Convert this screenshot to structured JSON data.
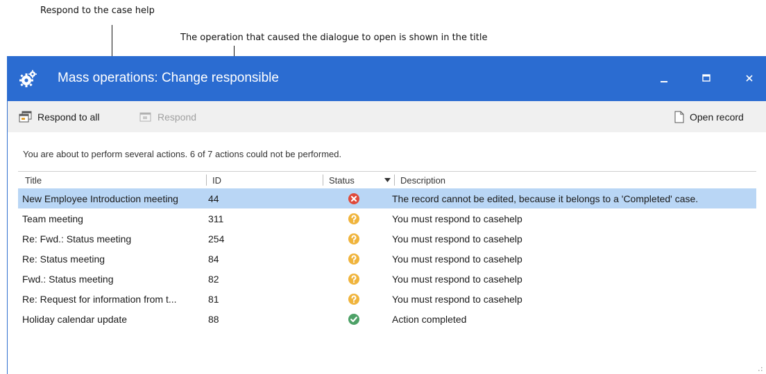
{
  "annotations": {
    "respond_help": "Respond to the case help",
    "title_note": "The operation that caused the dialogue to open is shown in the title"
  },
  "window": {
    "title": "Mass operations: Change responsible",
    "icon": "gears-icon",
    "controls": [
      "minimize-icon",
      "maximize-icon",
      "close-icon"
    ],
    "accent_color": "#2b6cd1"
  },
  "toolbar": {
    "respond_all_label": "Respond to all",
    "respond_label": "Respond",
    "open_record_label": "Open record"
  },
  "message": "You are about to perform several actions. 6 of 7 actions could not be performed.",
  "grid": {
    "columns": {
      "title": "Title",
      "id": "ID",
      "status": "Status",
      "description": "Description"
    },
    "rows": [
      {
        "title": "New Employee Introduction meeting",
        "id": "44",
        "status": "error",
        "description": "The record cannot be edited, because it belongs to a 'Completed' case."
      },
      {
        "title": "Team meeting",
        "id": "311",
        "status": "question",
        "description": "You must respond to casehelp"
      },
      {
        "title": "Re: Fwd.: Status meeting",
        "id": "254",
        "status": "question",
        "description": "You must respond to casehelp"
      },
      {
        "title": "Re: Status meeting",
        "id": "84",
        "status": "question",
        "description": "You must respond to casehelp"
      },
      {
        "title": "Fwd.: Status meeting",
        "id": "82",
        "status": "question",
        "description": "You must respond to casehelp"
      },
      {
        "title": "Re: Request for information from t...",
        "id": "81",
        "status": "question",
        "description": "You must respond to casehelp"
      },
      {
        "title": "Holiday calendar update",
        "id": "88",
        "status": "success",
        "description": "Action completed"
      }
    ],
    "status_colors": {
      "error": "#e04a3a",
      "question": "#f0b43c",
      "success": "#4da167"
    },
    "selected_row_color": "#b9d6f5"
  }
}
